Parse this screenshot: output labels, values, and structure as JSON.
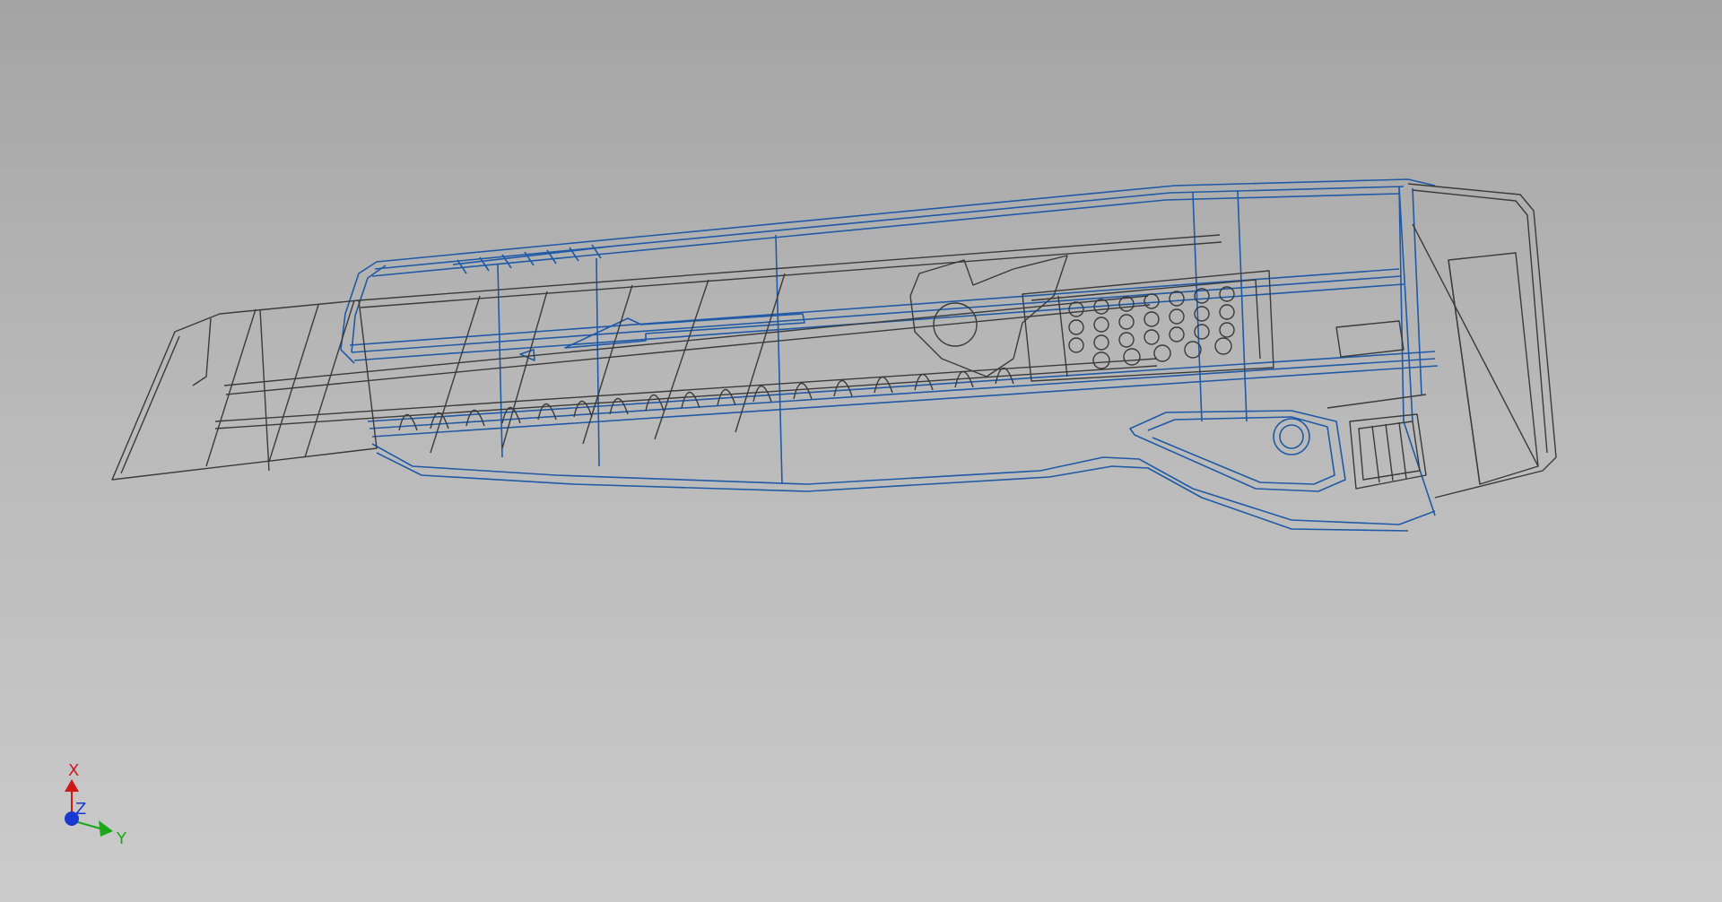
{
  "viewport": {
    "background_top": "#a4a4a4",
    "background_bottom": "#cbcbcb",
    "body_color": "#1f5aa6",
    "blade_color": "#3a3a3a"
  },
  "model": {
    "icon": "utility-knife-wireframe"
  },
  "triad": {
    "x_label": "X",
    "y_label": "Y",
    "z_label": "Z",
    "x_color": "#d01818",
    "y_color": "#18a818",
    "z_color": "#1838d0"
  }
}
